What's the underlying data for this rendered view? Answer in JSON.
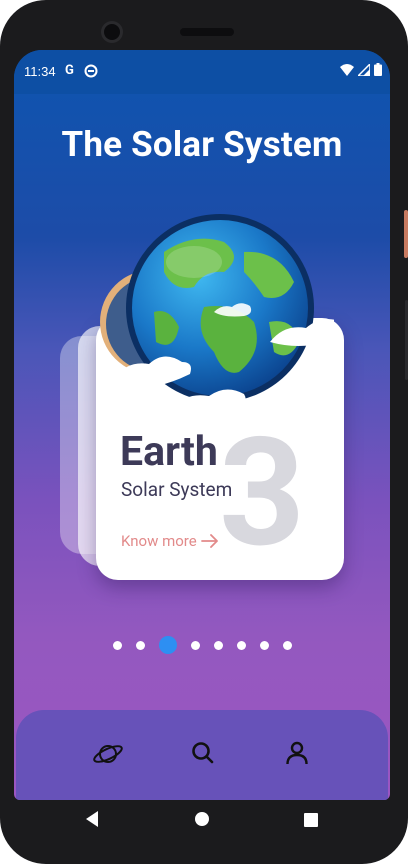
{
  "status_bar": {
    "time": "11:34",
    "g_label": "G",
    "icons": [
      "google-icon",
      "data-saver-icon",
      "wifi-icon",
      "signal-icon",
      "battery-icon"
    ]
  },
  "page": {
    "title": "The Solar System"
  },
  "planet_card": {
    "name": "Earth",
    "subtitle": "Solar System",
    "number": "3",
    "link_label": "Know more",
    "link_icon": "arrow-right-icon",
    "image": "earth-icon"
  },
  "pager": {
    "count": 8,
    "active_index": 2
  },
  "bottom_nav": {
    "items": [
      {
        "icon": "planet-icon"
      },
      {
        "icon": "search-icon"
      },
      {
        "icon": "user-icon"
      }
    ]
  },
  "system_nav": {
    "items": [
      "back-icon",
      "home-icon",
      "recents-icon"
    ]
  },
  "colors": {
    "gradient_top": "#0d55b0",
    "gradient_bottom": "#9c56c2",
    "card_bg": "#ffffff",
    "text_dark": "#3d3a58",
    "link": "#e28a8a",
    "number_gray": "#d8d8de",
    "active_dot": "#2d8ff2",
    "nav_bg": "#6752b9"
  }
}
